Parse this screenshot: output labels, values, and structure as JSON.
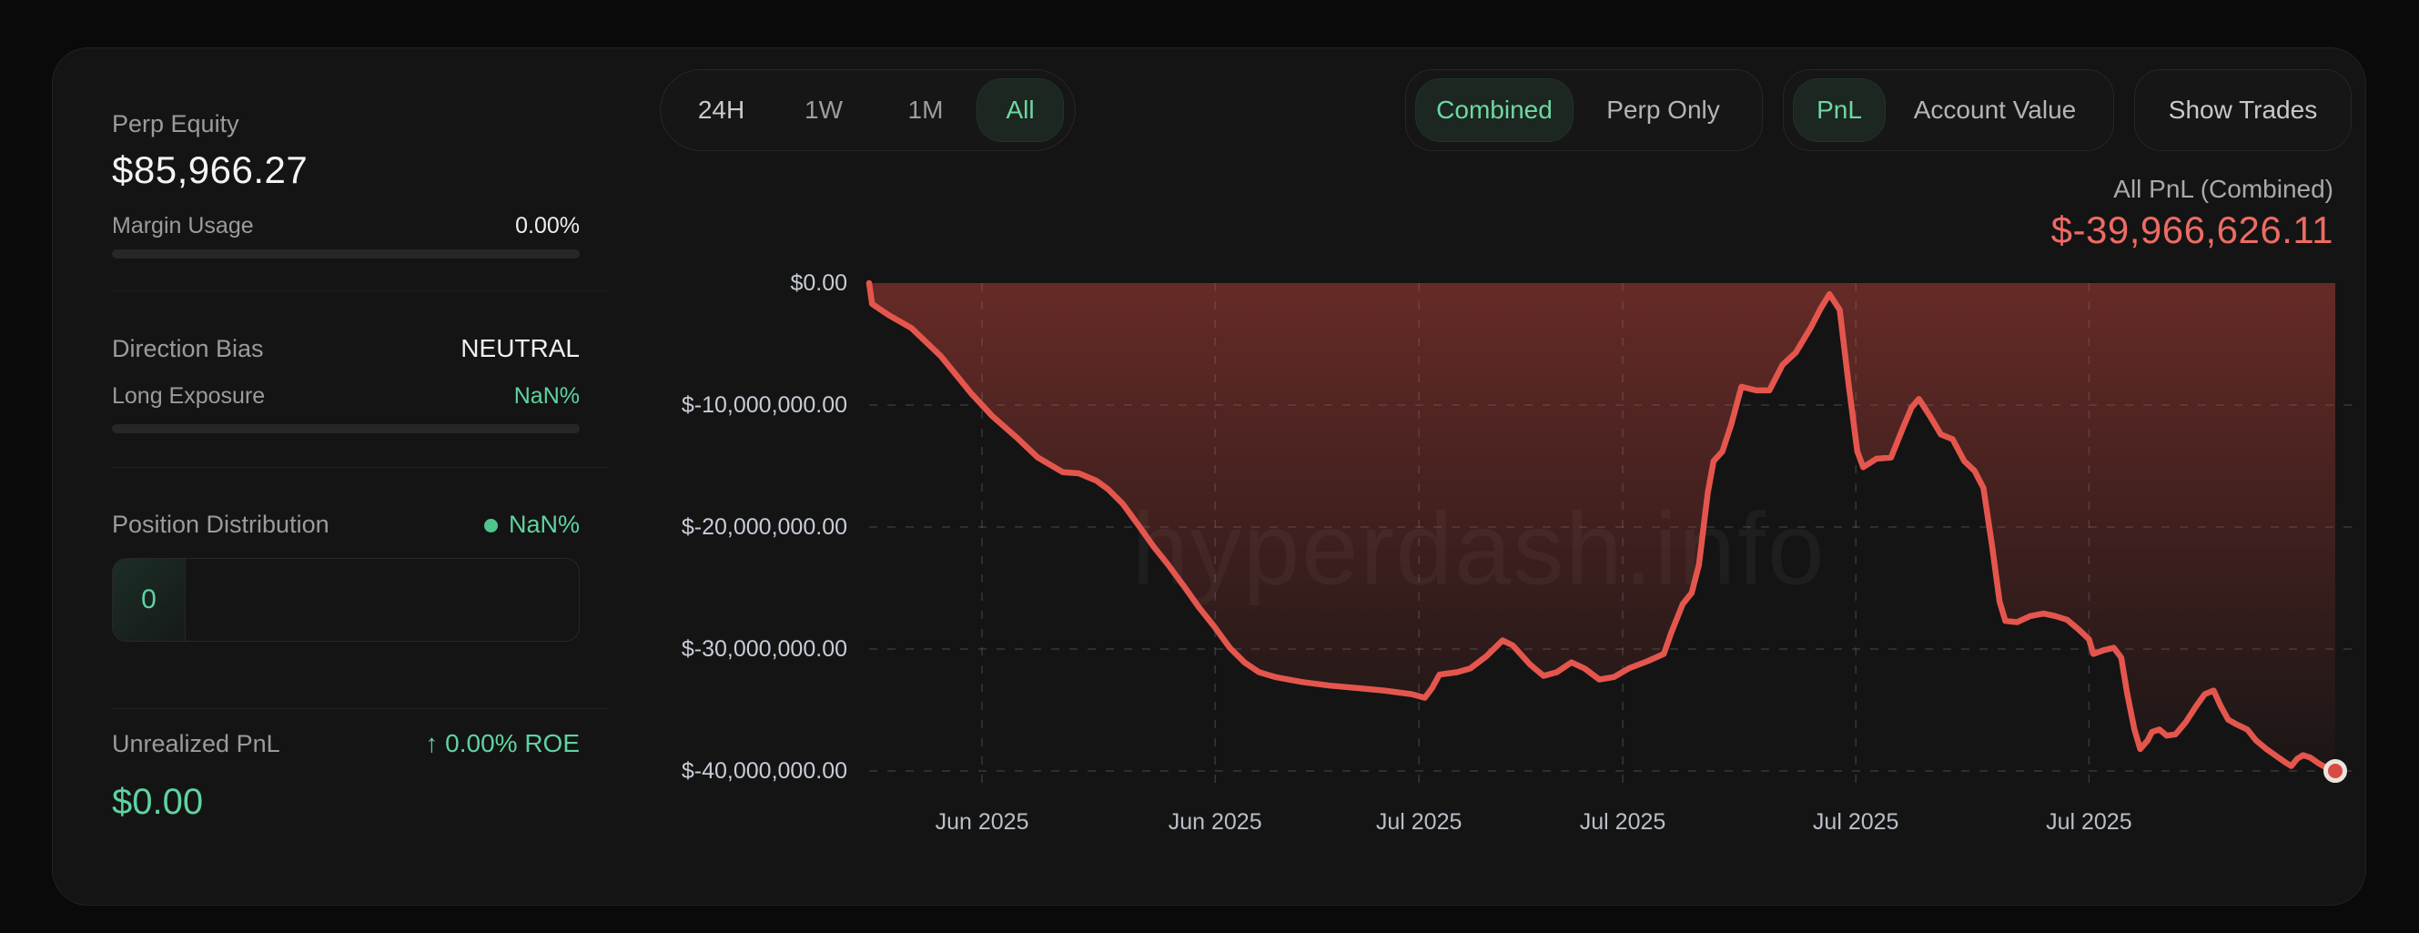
{
  "accent": {
    "green": "#5fd3a0",
    "red_line": "#e4564d",
    "red_fill": "#e04c42",
    "red_text": "#ee6b64"
  },
  "sidebar": {
    "perp_equity_label": "Perp Equity",
    "perp_equity_value": "$85,966.27",
    "margin_usage_label": "Margin Usage",
    "margin_usage_value": "0.00%",
    "direction_bias_label": "Direction Bias",
    "direction_bias_value": "NEUTRAL",
    "long_exposure_label": "Long Exposure",
    "long_exposure_value": "NaN%",
    "position_distribution_label": "Position Distribution",
    "position_distribution_value": "NaN%",
    "distribution_box_value": "0",
    "unrealized_pnl_label": "Unrealized PnL",
    "roe_arrow": "↑",
    "roe_value": "0.00% ROE",
    "unrealized_pnl_value": "$0.00"
  },
  "controls": {
    "time_ranges": [
      {
        "label": "24H",
        "selected": false
      },
      {
        "label": "1W",
        "selected": false
      },
      {
        "label": "1M",
        "selected": false
      },
      {
        "label": "All",
        "selected": true
      }
    ],
    "view_modes": [
      {
        "label": "Combined",
        "selected": true
      },
      {
        "label": "Perp Only",
        "selected": false
      }
    ],
    "metric_modes": [
      {
        "label": "PnL",
        "selected": true
      },
      {
        "label": "Account Value",
        "selected": false
      }
    ],
    "show_trades_label": "Show Trades"
  },
  "chart_header": {
    "title": "All PnL (Combined)",
    "value": "$-39,966,626.11"
  },
  "watermark": "hyperdash.info",
  "chart_data": {
    "type": "area",
    "title": "All PnL (Combined)",
    "final_value_label": "$-39,966,626.11",
    "units": "USD millions",
    "ylim": [
      -40,
      0
    ],
    "grid": "dashed",
    "y_ticks": [
      {
        "value": 0,
        "label": "$0.00"
      },
      {
        "value": -10,
        "label": "$-10,000,000.00"
      },
      {
        "value": -20,
        "label": "$-20,000,000.00"
      },
      {
        "value": -30,
        "label": "$-30,000,000.00"
      },
      {
        "value": -40,
        "label": "$-40,000,000.00"
      }
    ],
    "x_ticks": [
      {
        "pos": 0.077,
        "label": "Jun 2025"
      },
      {
        "pos": 0.236,
        "label": "Jun 2025"
      },
      {
        "pos": 0.375,
        "label": "Jul 2025"
      },
      {
        "pos": 0.514,
        "label": "Jul 2025"
      },
      {
        "pos": 0.673,
        "label": "Jul 2025"
      },
      {
        "pos": 0.832,
        "label": "Jul 2025"
      }
    ],
    "series": [
      {
        "name": "All PnL (Combined)",
        "points": [
          [
            0.0,
            0.0
          ],
          [
            0.002,
            -1.7
          ],
          [
            0.013,
            -2.6
          ],
          [
            0.029,
            -3.7
          ],
          [
            0.049,
            -6.0
          ],
          [
            0.07,
            -9.1
          ],
          [
            0.084,
            -10.9
          ],
          [
            0.101,
            -12.7
          ],
          [
            0.115,
            -14.3
          ],
          [
            0.132,
            -15.5
          ],
          [
            0.143,
            -15.6
          ],
          [
            0.155,
            -16.2
          ],
          [
            0.163,
            -16.9
          ],
          [
            0.173,
            -18.1
          ],
          [
            0.184,
            -19.9
          ],
          [
            0.194,
            -21.6
          ],
          [
            0.204,
            -23.1
          ],
          [
            0.215,
            -24.9
          ],
          [
            0.225,
            -26.6
          ],
          [
            0.235,
            -28.1
          ],
          [
            0.246,
            -29.9
          ],
          [
            0.256,
            -31.1
          ],
          [
            0.266,
            -31.9
          ],
          [
            0.277,
            -32.3
          ],
          [
            0.295,
            -32.7
          ],
          [
            0.314,
            -33.0
          ],
          [
            0.333,
            -33.2
          ],
          [
            0.351,
            -33.4
          ],
          [
            0.37,
            -33.7
          ],
          [
            0.379,
            -34.0
          ],
          [
            0.384,
            -33.2
          ],
          [
            0.389,
            -32.1
          ],
          [
            0.401,
            -31.9
          ],
          [
            0.41,
            -31.6
          ],
          [
            0.421,
            -30.6
          ],
          [
            0.432,
            -29.3
          ],
          [
            0.439,
            -29.7
          ],
          [
            0.451,
            -31.3
          ],
          [
            0.46,
            -32.2
          ],
          [
            0.469,
            -31.9
          ],
          [
            0.479,
            -31.1
          ],
          [
            0.488,
            -31.6
          ],
          [
            0.498,
            -32.5
          ],
          [
            0.508,
            -32.3
          ],
          [
            0.518,
            -31.6
          ],
          [
            0.531,
            -31.0
          ],
          [
            0.542,
            -30.4
          ],
          [
            0.547,
            -28.7
          ],
          [
            0.555,
            -26.3
          ],
          [
            0.561,
            -25.4
          ],
          [
            0.566,
            -23.1
          ],
          [
            0.572,
            -17.2
          ],
          [
            0.576,
            -14.6
          ],
          [
            0.582,
            -13.8
          ],
          [
            0.588,
            -11.6
          ],
          [
            0.595,
            -8.5
          ],
          [
            0.605,
            -8.8
          ],
          [
            0.614,
            -8.8
          ],
          [
            0.623,
            -6.7
          ],
          [
            0.632,
            -5.7
          ],
          [
            0.642,
            -3.7
          ],
          [
            0.649,
            -2.1
          ],
          [
            0.655,
            -0.9
          ],
          [
            0.662,
            -2.2
          ],
          [
            0.668,
            -8.2
          ],
          [
            0.674,
            -13.8
          ],
          [
            0.678,
            -15.1
          ],
          [
            0.687,
            -14.4
          ],
          [
            0.697,
            -14.3
          ],
          [
            0.705,
            -11.9
          ],
          [
            0.711,
            -10.2
          ],
          [
            0.716,
            -9.5
          ],
          [
            0.724,
            -11.0
          ],
          [
            0.731,
            -12.4
          ],
          [
            0.739,
            -12.8
          ],
          [
            0.747,
            -14.6
          ],
          [
            0.754,
            -15.4
          ],
          [
            0.76,
            -16.8
          ],
          [
            0.766,
            -21.6
          ],
          [
            0.771,
            -26.1
          ],
          [
            0.775,
            -27.7
          ],
          [
            0.783,
            -27.8
          ],
          [
            0.792,
            -27.3
          ],
          [
            0.801,
            -27.1
          ],
          [
            0.809,
            -27.3
          ],
          [
            0.817,
            -27.6
          ],
          [
            0.825,
            -28.4
          ],
          [
            0.832,
            -29.2
          ],
          [
            0.835,
            -30.4
          ],
          [
            0.842,
            -30.1
          ],
          [
            0.849,
            -29.9
          ],
          [
            0.854,
            -30.7
          ],
          [
            0.858,
            -33.6
          ],
          [
            0.863,
            -36.6
          ],
          [
            0.867,
            -38.2
          ],
          [
            0.872,
            -37.5
          ],
          [
            0.875,
            -36.8
          ],
          [
            0.88,
            -36.6
          ],
          [
            0.885,
            -37.1
          ],
          [
            0.891,
            -37.0
          ],
          [
            0.898,
            -36.0
          ],
          [
            0.905,
            -34.7
          ],
          [
            0.911,
            -33.7
          ],
          [
            0.917,
            -33.4
          ],
          [
            0.922,
            -34.7
          ],
          [
            0.927,
            -35.8
          ],
          [
            0.933,
            -36.2
          ],
          [
            0.94,
            -36.6
          ],
          [
            0.946,
            -37.5
          ],
          [
            0.953,
            -38.2
          ],
          [
            0.96,
            -38.8
          ],
          [
            0.966,
            -39.3
          ],
          [
            0.97,
            -39.6
          ],
          [
            0.974,
            -39.0
          ],
          [
            0.978,
            -38.7
          ],
          [
            0.983,
            -38.9
          ],
          [
            0.989,
            -39.4
          ],
          [
            0.995,
            -39.8
          ],
          [
            1.0,
            -40.0
          ]
        ]
      }
    ]
  }
}
